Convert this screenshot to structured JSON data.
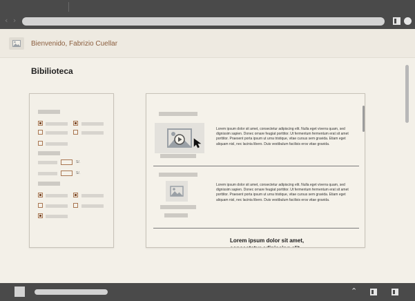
{
  "browser": {
    "nav_arrows": "‹ ›",
    "url_text": ""
  },
  "header": {
    "welcome": "Bienvenido, Fabrizio Cuellar",
    "avatar_icon": "image-placeholder-icon"
  },
  "page": {
    "title": "Bibilioteca"
  },
  "filters": {
    "range_rows": [
      {
        "separator": "S/."
      },
      {
        "separator": "S/."
      }
    ],
    "checkbox_groups": [
      {
        "rows": [
          [
            true,
            true
          ],
          [
            false,
            false
          ],
          [
            false
          ]
        ]
      },
      {
        "rows": [
          [
            true,
            true
          ],
          [
            false,
            false
          ],
          [
            true
          ]
        ]
      }
    ]
  },
  "results": {
    "items": [
      {
        "thumbnail_icon": "video-thumbnail-icon",
        "description": "Lorem ipsum dolor sit amet, consectetur adipiscing elit. Nulla eget viverra quam, sed dignissim sapien. Donec ornare feugiat porttitor. Ut fermentum fermentum erat sit amet porttitor. Praesent porta ipsum ut urna tristique, vitae cursus sem gravida. Etiam eget aliquam nisl, nec lacinia libero. Duis vestibulum facilisis eros vitae gravida."
      },
      {
        "thumbnail_icon": "image-thumbnail-icon",
        "description": "Lorem ipsum dolor sit amet, consectetur adipiscing elit. Nulla eget viverra quam, sed dignissim sapien. Donec ornare feugiat porttitor. Ut fermentum fermentum erat sit amet porttitor. Praesent porta ipsum ut urna tristique, vitae cursus sem gravida. Etiam eget aliquam nisl, nec lacinia libero. Duis vestibulum facilisis eros vitae gravida."
      },
      {
        "title": "Lorem ipsum dolor sit amet, consectetur adipiscing elit."
      }
    ]
  },
  "taskbar": {
    "up_icon": "chevron-up-icon"
  },
  "colors": {
    "chrome": "#4a4a4a",
    "accent_brown": "#a87550",
    "page_bg": "#f3f0e8"
  }
}
